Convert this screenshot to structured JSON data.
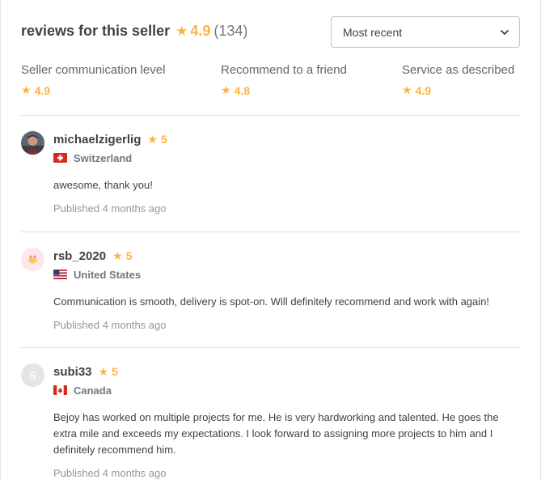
{
  "header": {
    "title": "reviews for this seller",
    "rating": "4.9",
    "count": "(134)",
    "sort_value": "Most recent"
  },
  "breakdown": [
    {
      "label": "Seller communication level",
      "value": "4.9"
    },
    {
      "label": "Recommend to a friend",
      "value": "4.8"
    },
    {
      "label": "Service as described",
      "value": "4.9"
    }
  ],
  "reviews": [
    {
      "username": "michaelzigerlig",
      "score": "5",
      "country": "Switzerland",
      "text": "awesome, thank you!",
      "date": "Published 4 months ago",
      "avatar_initial": ""
    },
    {
      "username": "rsb_2020",
      "score": "5",
      "country": "United States",
      "text": "Communication is smooth, delivery is spot-on. Will definitely recommend and work with again!",
      "date": "Published 4 months ago",
      "avatar_initial": ""
    },
    {
      "username": "subi33",
      "score": "5",
      "country": "Canada",
      "text": "Bejoy has worked on multiple projects for me. He is very hardworking and talented. He goes the extra mile and exceeds my expectations. I look forward to assigning more projects to him and I definitely recommend him.",
      "date": "Published 4 months ago",
      "avatar_initial": "S"
    }
  ],
  "colors": {
    "star": "#ffb33e",
    "text": "#404145",
    "muted": "#74767e"
  },
  "icons": {
    "star": "star-icon",
    "sort": "chevron-down-icon"
  }
}
